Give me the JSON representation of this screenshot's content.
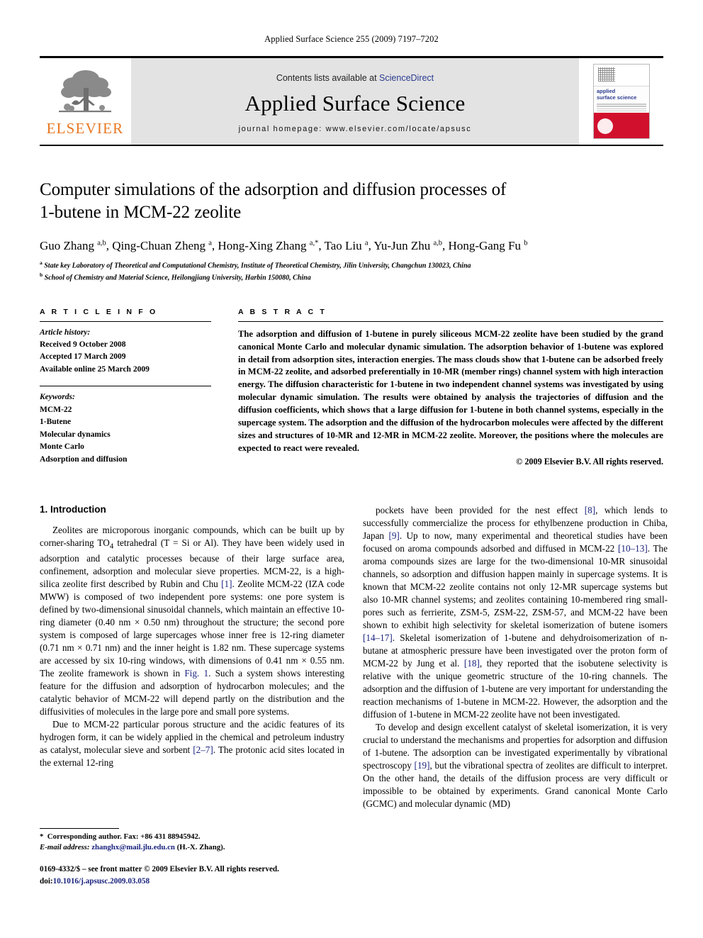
{
  "running_head": "Applied Surface Science 255 (2009) 7197–7202",
  "masthead": {
    "publisher_name": "ELSEVIER",
    "contents_prefix": "Contents lists available at ",
    "contents_link": "ScienceDirect",
    "journal_title": "Applied Surface Science",
    "homepage": "journal homepage: www.elsevier.com/locate/apsusc",
    "cover": {
      "title_line1": "applied",
      "title_line2": "surface science"
    }
  },
  "article": {
    "title_line1": "Computer simulations of the adsorption and diffusion processes of",
    "title_line2": "1-butene in MCM-22 zeolite",
    "authors_html": "Guo Zhang <sup>a,b</sup>, Qing-Chuan Zheng <sup>a</sup>, Hong-Xing Zhang <sup>a,*</sup>, Tao Liu <sup>a</sup>, Yu-Jun Zhu <sup>a,b</sup>, Hong-Gang Fu <sup>b</sup>",
    "affiliation_a": "State key Laboratory of Theoretical and Computational Chemistry, Institute of Theoretical Chemistry, Jilin University, Changchun 130023, China",
    "affiliation_b": "School of Chemistry and Material Science, Heilongjiang University, Harbin 150080, China"
  },
  "article_info": {
    "heading": "A R T I C L E  I N F O",
    "history_label": "Article history:",
    "history": [
      "Received 9 October 2008",
      "Accepted 17 March 2009",
      "Available online 25 March 2009"
    ],
    "keywords_label": "Keywords:",
    "keywords": [
      "MCM-22",
      "1-Butene",
      "Molecular dynamics",
      "Monte Carlo",
      "Adsorption and diffusion"
    ]
  },
  "abstract": {
    "heading": "A B S T R A C T",
    "text": "The adsorption and diffusion of 1-butene in purely siliceous MCM-22 zeolite have been studied by the grand canonical Monte Carlo and molecular dynamic simulation. The adsorption behavior of 1-butene was explored in detail from adsorption sites, interaction energies. The mass clouds show that 1-butene can be adsorbed freely in MCM-22 zeolite, and adsorbed preferentially in 10-MR (member rings) channel system with high interaction energy. The diffusion characteristic for 1-butene in two independent channel systems was investigated by using molecular dynamic simulation. The results were obtained by analysis the trajectories of diffusion and the diffusion coefficients, which shows that a large diffusion for 1-butene in both channel systems, especially in the supercage system. The adsorption and the diffusion of the hydrocarbon molecules were affected by the different sizes and structures of 10-MR and 12-MR in MCM-22 zeolite. Moreover, the positions where the molecules are expected to react were revealed.",
    "copyright": "© 2009 Elsevier B.V. All rights reserved."
  },
  "body": {
    "section_title": "1. Introduction",
    "left_paragraph_1_html": "Zeolites are microporous inorganic compounds, which can be built up by corner-sharing TO<sub>4</sub> tetrahedral (T = Si or Al). They have been widely used in adsorption and catalytic processes because of their large surface area, confinement, adsorption and molecular sieve properties. MCM-22, is a high-silica zeolite first described by Rubin and Chu <span class=\"ref\">[1]</span>. Zeolite MCM-22 (IZA code MWW) is composed of two independent pore systems: one pore system is defined by two-dimensional sinusoidal channels, which maintain an effective 10-ring diameter (0.40 nm &#215; 0.50 nm) throughout the structure; the second pore system is composed of large supercages whose inner free is 12-ring diameter (0.71 nm &#215; 0.71 nm) and the inner height is 1.82 nm. These supercage systems are accessed by six 10-ring windows, with dimensions of 0.41 nm &#215; 0.55 nm. The zeolite framework is shown in <span class=\"figref\">Fig. 1</span>. Such a system shows interesting feature for the diffusion and adsorption of hydrocarbon molecules; and the catalytic behavior of MCM-22 will depend partly on the distribution and the diffusivities of molecules in the large pore and small pore systems.",
    "left_paragraph_2_html": "Due to MCM-22 particular porous structure and the acidic features of its hydrogen form, it can be widely applied in the chemical and petroleum industry as catalyst, molecular sieve and sorbent <span class=\"ref\">[2&#8211;7]</span>. The protonic acid sites located in the external 12-ring",
    "right_paragraph_1_html": "pockets have been provided for the nest effect <span class=\"ref\">[8]</span>, which lends to successfully commercialize the process for ethylbenzene production in Chiba, Japan <span class=\"ref\">[9]</span>. Up to now, many experimental and theoretical studies have been focused on aroma compounds adsorbed and diffused in MCM-22 <span class=\"ref\">[10&#8211;13]</span>. The aroma compounds sizes are large for the two-dimensional 10-MR sinusoidal channels, so adsorption and diffusion happen mainly in supercage systems. It is known that MCM-22 zeolite contains not only 12-MR supercage systems but also 10-MR channel systems; and zeolites containing 10-membered ring small-pores such as ferrierite, ZSM-5, ZSM-22, ZSM-57, and MCM-22 have been shown to exhibit high selectivity for skeletal isomerization of butene isomers <span class=\"ref\">[14&#8211;17]</span>. Skeletal isomerization of 1-butene and dehydroisomerization of n-butane at atmospheric pressure have been investigated over the proton form of MCM-22 by Jung et al. <span class=\"ref\">[18]</span>, they reported that the isobutene selectivity is relative with the unique geometric structure of the 10-ring channels. The adsorption and the diffusion of 1-butene are very important for understanding the reaction mechanisms of 1-butene in MCM-22. However, the adsorption and the diffusion of 1-butene in MCM-22 zeolite have not been investigated.",
    "right_paragraph_2_html": "To develop and design excellent catalyst of skeletal isomerization, it is very crucial to understand the mechanisms and properties for adsorption and diffusion of 1-butene. The adsorption can be investigated experimentally by vibrational spectroscopy <span class=\"ref\">[19]</span>, but the vibrational spectra of zeolites are difficult to interpret. On the other hand, the details of the diffusion process are very difficult or impossible to be obtained by experiments. Grand canonical Monte Carlo (GCMC) and molecular dynamic (MD)"
  },
  "footnote": {
    "corresponding_html": "<span class=\"star\">*</span> &nbsp;Corresponding author. Fax: +86 431 88945942.",
    "email_html": "<span class=\"ital\">E-mail address:</span> <span class=\"mail\">zhanghx@mail.jlu.edu.cn</span> (H.-X. Zhang)."
  },
  "footer": {
    "issn_line_html": "0169-4332/$ &#8211; see front matter &#169; 2009 Elsevier B.V. All rights reserved.",
    "doi_html": "doi:<span class=\"doi-link\">10.1016/j.apsusc.2009.03.058</span>"
  }
}
